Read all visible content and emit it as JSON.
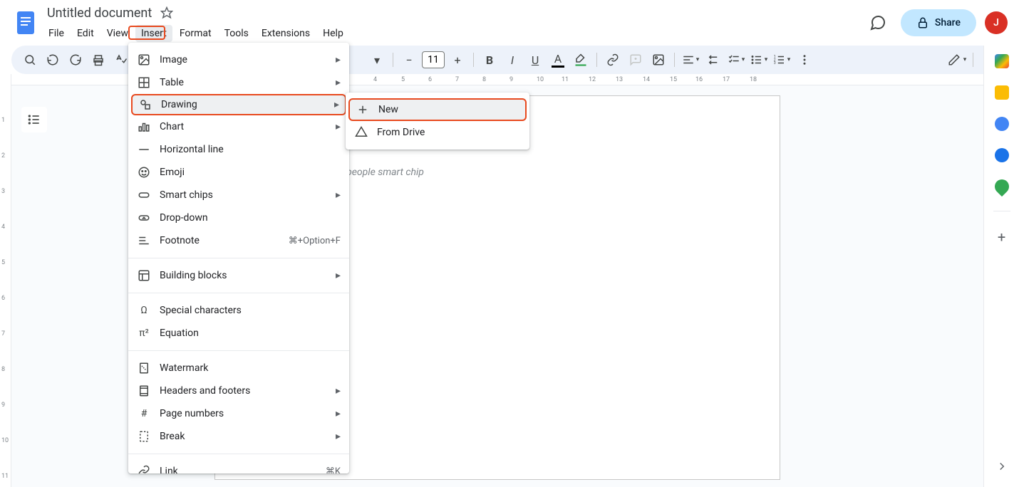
{
  "header": {
    "doc_title": "Untitled document",
    "avatar_initial": "J"
  },
  "menubar": {
    "file": "File",
    "edit": "Edit",
    "view": "View",
    "insert": "Insert",
    "format": "Format",
    "tools": "Tools",
    "extensions": "Extensions",
    "help": "Help"
  },
  "share": {
    "label": "Share"
  },
  "toolbar": {
    "font_size": "11"
  },
  "insert_menu": {
    "image": "Image",
    "table": "Table",
    "drawing": "Drawing",
    "chart": "Chart",
    "horizontal_line": "Horizontal line",
    "emoji": "Emoji",
    "smart_chips": "Smart chips",
    "dropdown": "Drop-down",
    "footnote": "Footnote",
    "footnote_shortcut": "⌘+Option+F",
    "building_blocks": "Building blocks",
    "special_characters": "Special characters",
    "equation": "Equation",
    "watermark": "Watermark",
    "headers_footers": "Headers and footers",
    "page_numbers": "Page numbers",
    "break": "Break",
    "link": "Link",
    "link_shortcut": "⌘K"
  },
  "drawing_submenu": {
    "new": "New",
    "from_drive": "From Drive"
  },
  "ruler": {
    "h_ticks": [
      "4",
      "5",
      "6",
      "7",
      "8",
      "9",
      "10",
      "11",
      "12",
      "13",
      "14",
      "15",
      "16",
      "17",
      "18"
    ],
    "v_ticks": [
      "1",
      "2",
      "3",
      "4",
      "5",
      "6",
      "7",
      "8",
      "9",
      "10",
      "11"
    ]
  },
  "document": {
    "placeholder": "Type @ to insert a people smart chip"
  }
}
